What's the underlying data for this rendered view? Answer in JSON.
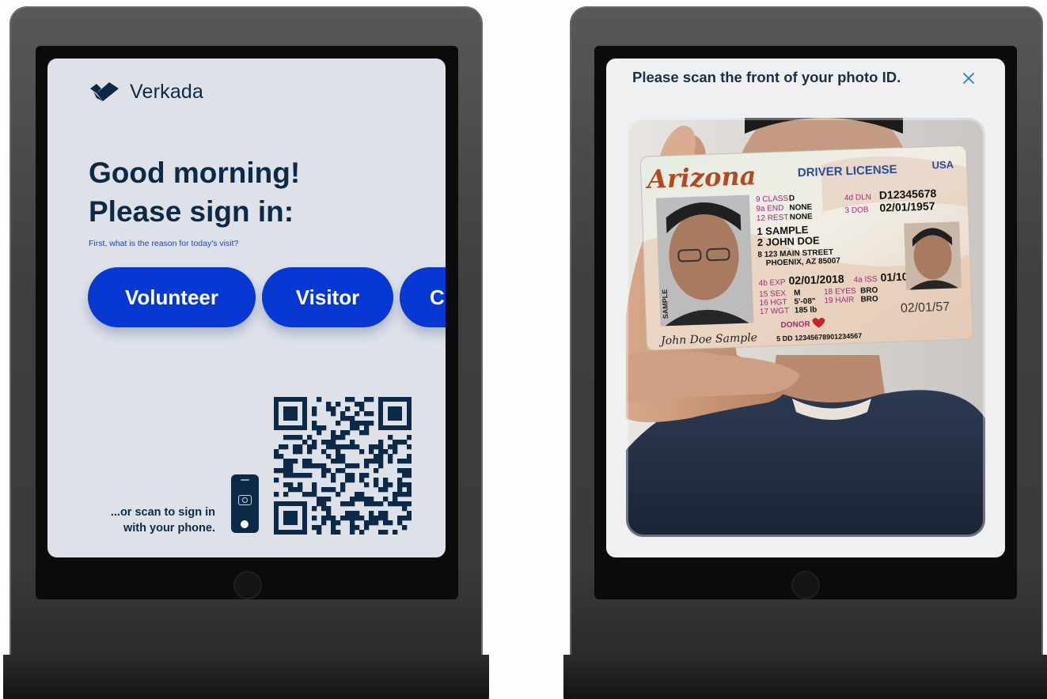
{
  "left_kiosk": {
    "brand": {
      "logo_icon": "verkada-logo-icon",
      "name": "Verkada"
    },
    "greeting_line1": "Good morning!",
    "greeting_line2": "Please sign in:",
    "reason_prompt": "First, what is the reason for today's visit?",
    "reason_options": [
      "Volunteer",
      "Visitor",
      "C"
    ],
    "scan_hint_line1": "...or scan to sign in",
    "scan_hint_line2": "with your phone.",
    "phone_icon": "phone-camera-icon",
    "qr_icon": "qr-code-icon"
  },
  "right_kiosk": {
    "instruction": "Please scan the front of your photo ID.",
    "close_icon": "close-icon",
    "id_card": {
      "state": "Arizona",
      "title": "DRIVER LICENSE",
      "country": "USA",
      "class_label": "9 CLASS",
      "class_value": "D",
      "end_label": "9a END",
      "end_value": "NONE",
      "rest_label": "12 REST",
      "rest_value": "NONE",
      "dln_label": "4d DLN",
      "dln_value": "D12345678",
      "dob_label": "3 DOB",
      "dob_value": "02/01/1957",
      "last_name": "1 SAMPLE",
      "first_name": "2 JOHN DOE",
      "address1": "8 123 MAIN STREET",
      "address2": "PHOENIX, AZ 85007",
      "exp_label": "4b EXP",
      "exp_value": "02/01/2018",
      "iss_label": "4a ISS",
      "iss_value": "01/10/2013",
      "sex_label": "15 SEX",
      "sex_value": "M",
      "hgt_label": "16 HGT",
      "hgt_value": "5'-08\"",
      "wgt_label": "17 WGT",
      "wgt_value": "185 lb",
      "eyes_label": "18 EYES",
      "eyes_value": "BRO",
      "hair_label": "19 HAIR",
      "hair_value": "BRO",
      "donor": "DONOR",
      "dd": "5 DD 12345678901234567",
      "dob_short": "02/01/57",
      "signature": "John Doe Sample",
      "sample_mark": "SAMPLE"
    }
  },
  "colors": {
    "navy": "#0c2a48",
    "button_blue": "#0838d4",
    "prompt_blue": "#1e40c8",
    "left_screen_bg": "#dee2e8",
    "id_title_blue": "#2a4a9c",
    "id_label_purple": "#a02a7a"
  }
}
